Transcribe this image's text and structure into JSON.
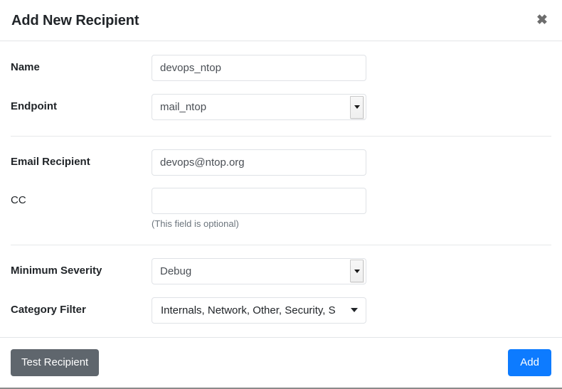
{
  "modal": {
    "title": "Add New Recipient",
    "close_icon": "close-icon",
    "close_glyph": "✖"
  },
  "form": {
    "fields": [
      {
        "label": "Name",
        "type": "text",
        "value": "devops_ntop",
        "placeholder": ""
      },
      {
        "label": "Endpoint",
        "type": "select",
        "value": "mail_ntop"
      },
      {
        "label": "Email Recipient",
        "type": "text",
        "value": "devops@ntop.org",
        "placeholder": ""
      },
      {
        "label": "CC",
        "type": "text",
        "value": "",
        "placeholder": "",
        "helper": "(This field is optional)"
      },
      {
        "label": "Minimum Severity",
        "type": "select",
        "value": "Debug"
      },
      {
        "label": "Category Filter",
        "type": "dropdown",
        "value": "Internals, Network, Other, Security, S"
      }
    ]
  },
  "footer": {
    "test_label": "Test Recipient",
    "add_label": "Add"
  },
  "colors": {
    "primary": "#0d7bff",
    "secondary": "#5f666d",
    "text": "#212529",
    "muted": "#6c757d",
    "border": "#dfe2e6"
  }
}
